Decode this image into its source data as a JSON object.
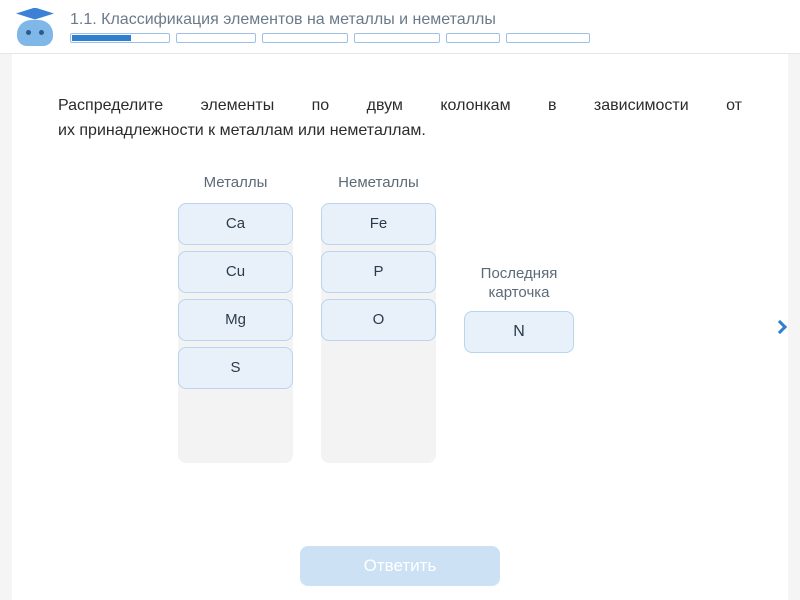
{
  "header": {
    "topic_title": "1.1. Классификация элементов на металлы и неметаллы",
    "progress_segments": [
      {
        "width": 100,
        "filled": true
      },
      {
        "width": 80,
        "filled": false
      },
      {
        "width": 86,
        "filled": false
      },
      {
        "width": 86,
        "filled": false
      },
      {
        "width": 54,
        "filled": false
      },
      {
        "width": 84,
        "filled": false
      }
    ]
  },
  "instruction": {
    "line1": "Распределите элементы по двум колонкам в  зависимости от",
    "line2": "их принадлежности к металлам или неметаллам."
  },
  "columns": {
    "metals": {
      "header": "Металлы",
      "items": [
        "Ca",
        "Cu",
        "Mg",
        "S"
      ]
    },
    "nonmetals": {
      "header": "Неметаллы",
      "items": [
        "Fe",
        "P",
        "O"
      ]
    }
  },
  "last_card": {
    "label_line1": "Последняя",
    "label_line2": "карточка",
    "value": "N"
  },
  "answer_button": "Ответить"
}
